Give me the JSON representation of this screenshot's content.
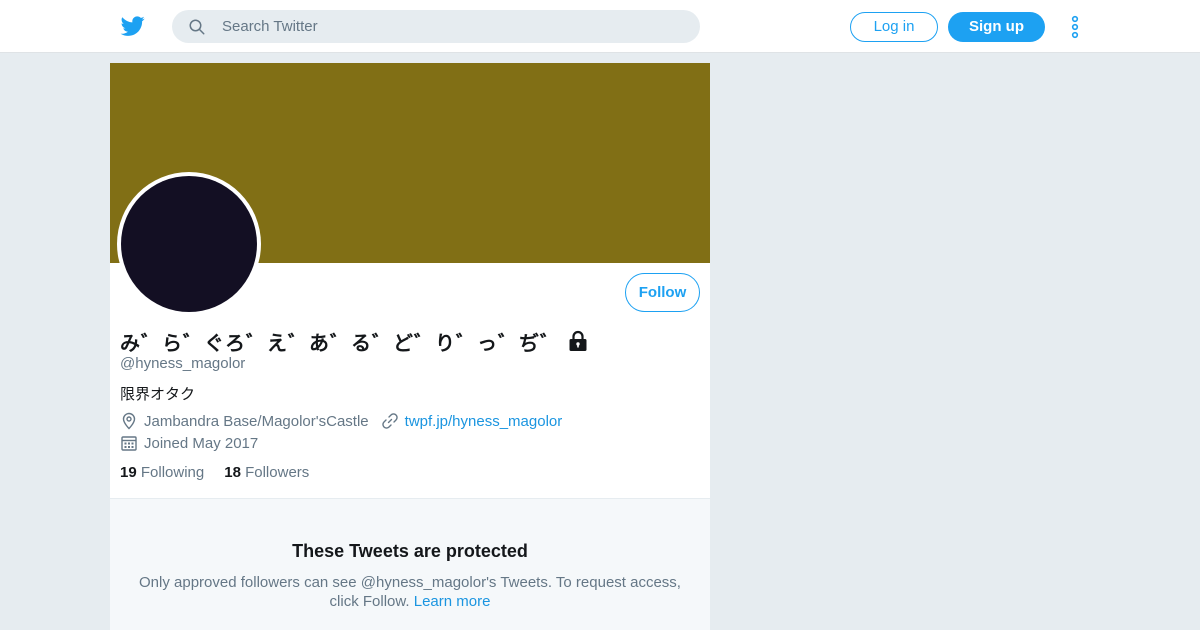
{
  "header": {
    "search_placeholder": "Search Twitter",
    "login_label": "Log in",
    "signup_label": "Sign up"
  },
  "profile": {
    "banner_color": "#816f15",
    "avatar_color": "#130f23",
    "display_name": "み゛ら゛ぐろ゛え゛あ゛る゛ど゛り゛っ゛ぢ゛",
    "handle": "@hyness_magolor",
    "bio": "限界オタク",
    "location": "Jambandra Base/Magolor'sCastle",
    "website": "twpf.jp/hyness_magolor",
    "joined": "Joined May 2017",
    "follow_label": "Follow",
    "following_count": "19",
    "following_label": "Following",
    "followers_count": "18",
    "followers_label": "Followers"
  },
  "protected_notice": {
    "title": "These Tweets are protected",
    "body": "Only approved followers can see @hyness_magolor's Tweets. To request access, click Follow.",
    "learn_more": "Learn more"
  },
  "colors": {
    "accent": "#1da1f2",
    "link": "#1b95e0",
    "page_bg": "#e6ecf0"
  },
  "icons": [
    "twitter-bird-icon",
    "search-icon",
    "more-vertical-icon",
    "lock-icon",
    "location-pin-icon",
    "link-icon",
    "calendar-icon"
  ]
}
